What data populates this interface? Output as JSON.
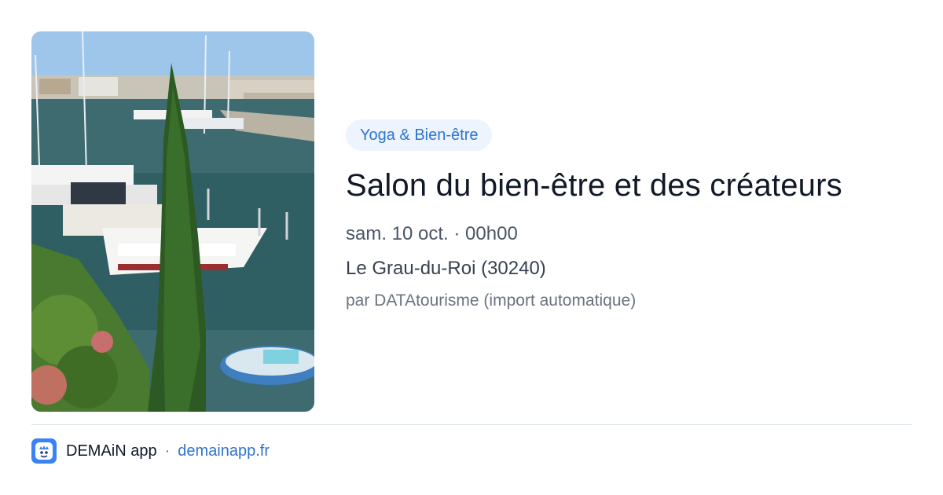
{
  "event": {
    "category": "Yoga & Bien-être",
    "title": "Salon du bien-être et des créateurs",
    "datetime": "sam. 10 oct. · 00h00",
    "location": "Le Grau-du-Roi (30240)",
    "source": "par DATAtourisme (import automatique)",
    "image_subject": "marina-with-boats-and-cypress-tree"
  },
  "footer": {
    "app_name": "DEMAiN app",
    "separator": "·",
    "domain": "demainapp.fr",
    "logo_icon": "demain-app-icon"
  },
  "colors": {
    "accent": "#2f74d0",
    "pill_background": "#eef4fd",
    "title": "#111827",
    "muted": "#6b7280",
    "divider": "#d9e2ea",
    "logo_background": "#3b82f6"
  }
}
